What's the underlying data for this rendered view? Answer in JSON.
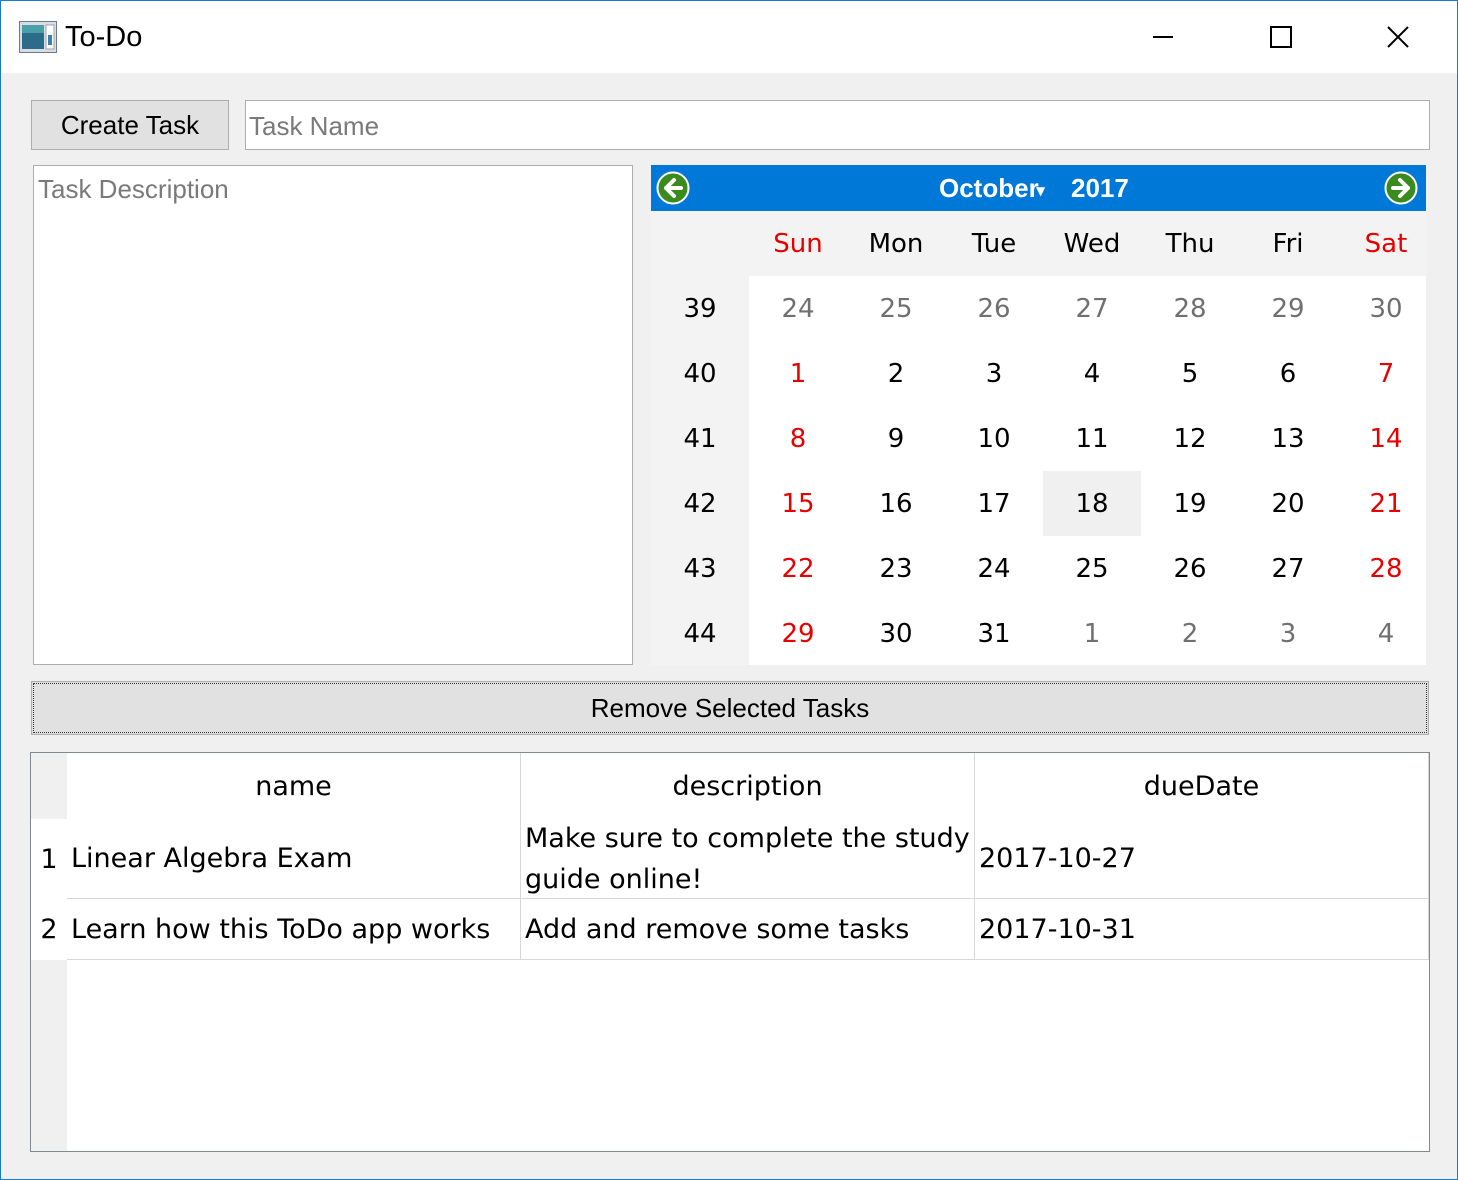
{
  "window": {
    "title": "To-Do",
    "controls": {
      "minimize": "minimize-icon",
      "maximize": "maximize-icon",
      "close": "close-icon"
    }
  },
  "toolbar": {
    "create_label": "Create Task",
    "task_name_placeholder": "Task Name",
    "task_name_value": ""
  },
  "description": {
    "placeholder": "Task Description",
    "value": ""
  },
  "calendar": {
    "month": "October",
    "year": "2017",
    "header_color": "#0078d7",
    "nav_color": "#3a8a1e",
    "weekend_color": "#e60000",
    "selected_day": "18",
    "day_names": [
      "Sun",
      "Mon",
      "Tue",
      "Wed",
      "Thu",
      "Fri",
      "Sat"
    ],
    "weeks": [
      {
        "num": "39",
        "days": [
          "24",
          "25",
          "26",
          "27",
          "28",
          "29",
          "30"
        ],
        "other": [
          true,
          true,
          true,
          true,
          true,
          true,
          true
        ]
      },
      {
        "num": "40",
        "days": [
          "1",
          "2",
          "3",
          "4",
          "5",
          "6",
          "7"
        ],
        "other": [
          false,
          false,
          false,
          false,
          false,
          false,
          false
        ]
      },
      {
        "num": "41",
        "days": [
          "8",
          "9",
          "10",
          "11",
          "12",
          "13",
          "14"
        ],
        "other": [
          false,
          false,
          false,
          false,
          false,
          false,
          false
        ]
      },
      {
        "num": "42",
        "days": [
          "15",
          "16",
          "17",
          "18",
          "19",
          "20",
          "21"
        ],
        "other": [
          false,
          false,
          false,
          false,
          false,
          false,
          false
        ]
      },
      {
        "num": "43",
        "days": [
          "22",
          "23",
          "24",
          "25",
          "26",
          "27",
          "28"
        ],
        "other": [
          false,
          false,
          false,
          false,
          false,
          false,
          false
        ]
      },
      {
        "num": "44",
        "days": [
          "29",
          "30",
          "31",
          "1",
          "2",
          "3",
          "4"
        ],
        "other": [
          false,
          false,
          false,
          true,
          true,
          true,
          true
        ]
      }
    ]
  },
  "remove_label": "Remove Selected Tasks",
  "table": {
    "columns": [
      "name",
      "description",
      "dueDate"
    ],
    "rows": [
      {
        "index": "1",
        "name": "Linear Algebra Exam",
        "description": "Make sure to complete the study guide online!",
        "dueDate": "2017-10-27"
      },
      {
        "index": "2",
        "name": "Learn how this ToDo app works",
        "description": "Add and remove some tasks",
        "dueDate": "2017-10-31"
      }
    ]
  }
}
